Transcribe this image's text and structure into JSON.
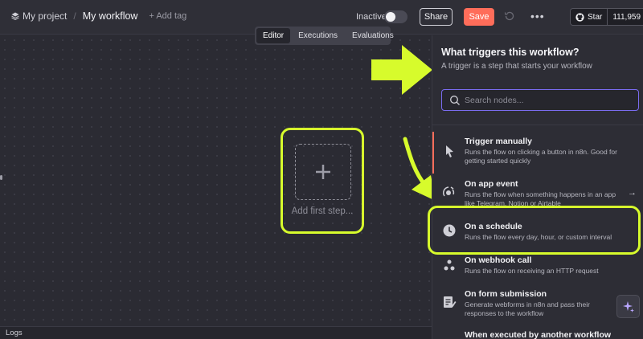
{
  "header": {
    "project": "My project",
    "separator": "/",
    "workflow_name": "My workflow",
    "add_tag": "+ Add tag",
    "status_label": "Inactive",
    "share_label": "Share",
    "save_label": "Save",
    "more_label": "•••",
    "github_star_label": "Star",
    "github_star_count": "111,959",
    "accent_color": "#ff6d5a"
  },
  "tabs": [
    {
      "label": "Editor",
      "active": true
    },
    {
      "label": "Executions",
      "active": false
    },
    {
      "label": "Evaluations",
      "active": false
    }
  ],
  "canvas": {
    "add_first_step": "Add first step...",
    "highlight_color": "#d7fb2c",
    "controls": [
      "fit-view-icon",
      "zoom-in-icon",
      "zoom-out-icon",
      "tidy-up-icon"
    ]
  },
  "logs": {
    "label": "Logs"
  },
  "panel": {
    "title": "What triggers this workflow?",
    "subtitle": "A trigger is a step that starts your workflow",
    "search_placeholder": "Search nodes...",
    "items": [
      {
        "icon": "pointer-icon",
        "title": "Trigger manually",
        "desc": "Runs the flow on clicking a button in n8n. Good for getting started quickly"
      },
      {
        "icon": "app-event-icon",
        "title": "On app event",
        "desc": "Runs the flow when something happens in an app like Telegram, Notion or Airtable"
      },
      {
        "icon": "clock-icon",
        "title": "On a schedule",
        "desc": "Runs the flow every day, hour, or custom interval"
      },
      {
        "icon": "webhook-icon",
        "title": "On webhook call",
        "desc": "Runs the flow on receiving an HTTP request"
      },
      {
        "icon": "form-icon",
        "title": "On form submission",
        "desc": "Generate webforms in n8n and pass their responses to the workflow"
      },
      {
        "icon": "workflow-icon",
        "title": "When executed by another workflow",
        "desc": ""
      }
    ]
  }
}
